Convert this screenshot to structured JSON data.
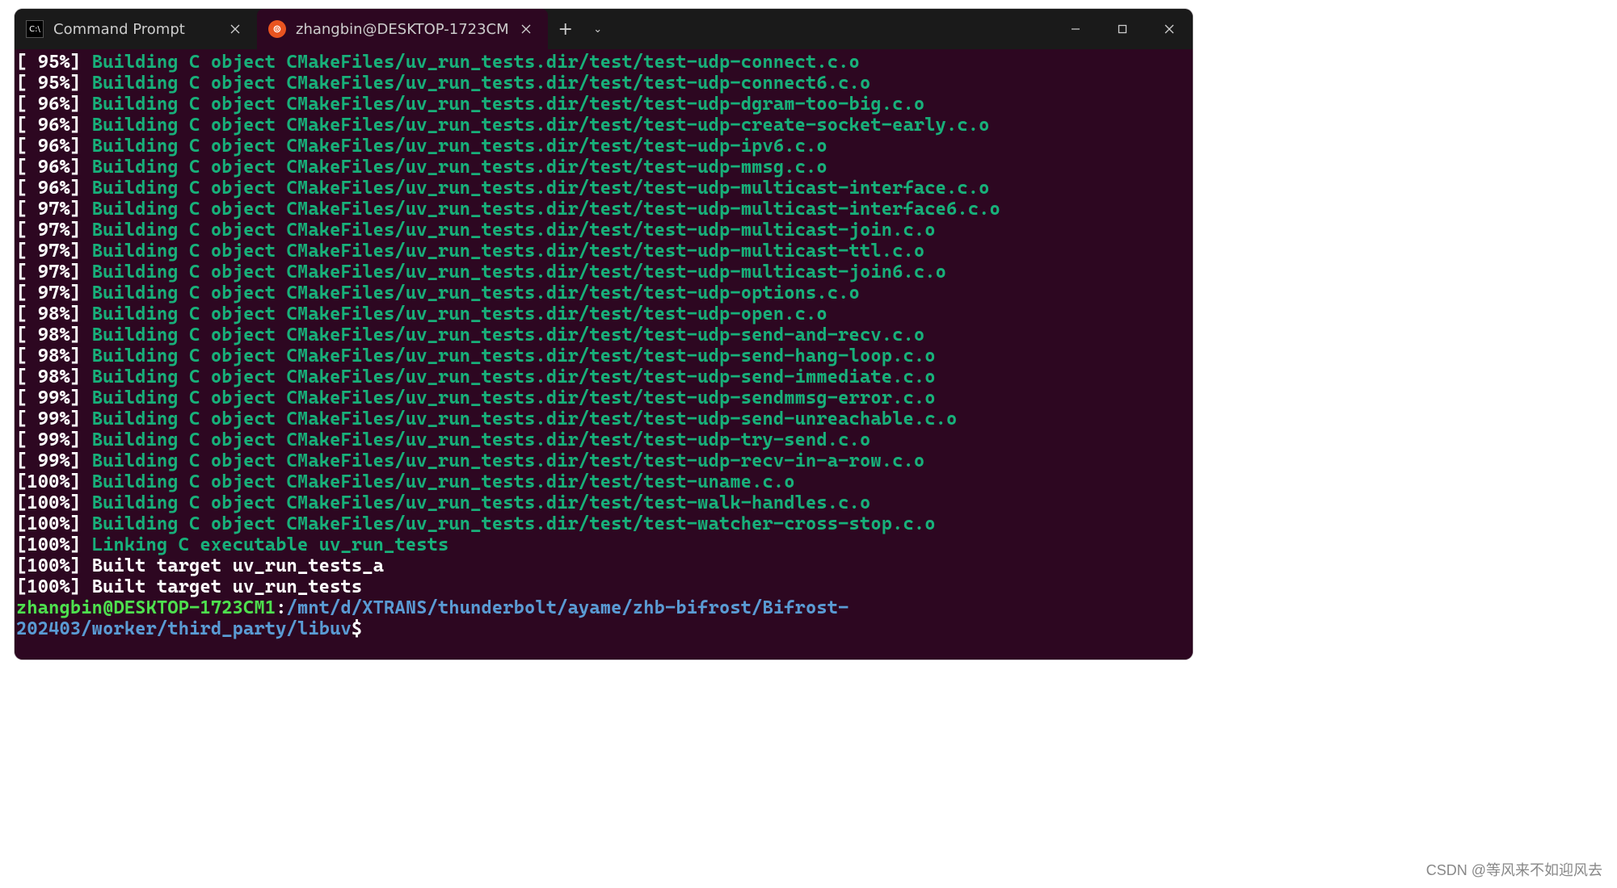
{
  "tabs": [
    {
      "label": "Command Prompt",
      "icon": "cmd",
      "active": false
    },
    {
      "label": "zhangbin@DESKTOP-1723CM",
      "icon": "ubu",
      "active": true
    }
  ],
  "lines": [
    {
      "pct": "[ 95%]",
      "kind": "build",
      "text": "Building C object CMakeFiles/uv_run_tests.dir/test/test-udp-connect.c.o"
    },
    {
      "pct": "[ 95%]",
      "kind": "build",
      "text": "Building C object CMakeFiles/uv_run_tests.dir/test/test-udp-connect6.c.o"
    },
    {
      "pct": "[ 96%]",
      "kind": "build",
      "text": "Building C object CMakeFiles/uv_run_tests.dir/test/test-udp-dgram-too-big.c.o"
    },
    {
      "pct": "[ 96%]",
      "kind": "build",
      "text": "Building C object CMakeFiles/uv_run_tests.dir/test/test-udp-create-socket-early.c.o"
    },
    {
      "pct": "[ 96%]",
      "kind": "build",
      "text": "Building C object CMakeFiles/uv_run_tests.dir/test/test-udp-ipv6.c.o"
    },
    {
      "pct": "[ 96%]",
      "kind": "build",
      "text": "Building C object CMakeFiles/uv_run_tests.dir/test/test-udp-mmsg.c.o"
    },
    {
      "pct": "[ 96%]",
      "kind": "build",
      "text": "Building C object CMakeFiles/uv_run_tests.dir/test/test-udp-multicast-interface.c.o"
    },
    {
      "pct": "[ 97%]",
      "kind": "build",
      "text": "Building C object CMakeFiles/uv_run_tests.dir/test/test-udp-multicast-interface6.c.o"
    },
    {
      "pct": "[ 97%]",
      "kind": "build",
      "text": "Building C object CMakeFiles/uv_run_tests.dir/test/test-udp-multicast-join.c.o"
    },
    {
      "pct": "[ 97%]",
      "kind": "build",
      "text": "Building C object CMakeFiles/uv_run_tests.dir/test/test-udp-multicast-ttl.c.o"
    },
    {
      "pct": "[ 97%]",
      "kind": "build",
      "text": "Building C object CMakeFiles/uv_run_tests.dir/test/test-udp-multicast-join6.c.o"
    },
    {
      "pct": "[ 97%]",
      "kind": "build",
      "text": "Building C object CMakeFiles/uv_run_tests.dir/test/test-udp-options.c.o"
    },
    {
      "pct": "[ 98%]",
      "kind": "build",
      "text": "Building C object CMakeFiles/uv_run_tests.dir/test/test-udp-open.c.o"
    },
    {
      "pct": "[ 98%]",
      "kind": "build",
      "text": "Building C object CMakeFiles/uv_run_tests.dir/test/test-udp-send-and-recv.c.o"
    },
    {
      "pct": "[ 98%]",
      "kind": "build",
      "text": "Building C object CMakeFiles/uv_run_tests.dir/test/test-udp-send-hang-loop.c.o"
    },
    {
      "pct": "[ 98%]",
      "kind": "build",
      "text": "Building C object CMakeFiles/uv_run_tests.dir/test/test-udp-send-immediate.c.o"
    },
    {
      "pct": "[ 99%]",
      "kind": "build",
      "text": "Building C object CMakeFiles/uv_run_tests.dir/test/test-udp-sendmmsg-error.c.o"
    },
    {
      "pct": "[ 99%]",
      "kind": "build",
      "text": "Building C object CMakeFiles/uv_run_tests.dir/test/test-udp-send-unreachable.c.o"
    },
    {
      "pct": "[ 99%]",
      "kind": "build",
      "text": "Building C object CMakeFiles/uv_run_tests.dir/test/test-udp-try-send.c.o"
    },
    {
      "pct": "[ 99%]",
      "kind": "build",
      "text": "Building C object CMakeFiles/uv_run_tests.dir/test/test-udp-recv-in-a-row.c.o"
    },
    {
      "pct": "[100%]",
      "kind": "build",
      "text": "Building C object CMakeFiles/uv_run_tests.dir/test/test-uname.c.o"
    },
    {
      "pct": "[100%]",
      "kind": "build",
      "text": "Building C object CMakeFiles/uv_run_tests.dir/test/test-walk-handles.c.o"
    },
    {
      "pct": "[100%]",
      "kind": "build",
      "text": "Building C object CMakeFiles/uv_run_tests.dir/test/test-watcher-cross-stop.c.o"
    },
    {
      "pct": "[100%]",
      "kind": "link",
      "text": "Linking C executable uv_run_tests"
    },
    {
      "pct": "[100%]",
      "kind": "plain",
      "text": "Built target uv_run_tests_a"
    },
    {
      "pct": "[100%]",
      "kind": "plain",
      "text": "Built target uv_run_tests"
    }
  ],
  "prompt": {
    "user": "zhangbin@DESKTOP-1723CM1",
    "colon": ":",
    "path": "/mnt/d/XTRANS/thunderbolt/ayame/zhb-bifrost/Bifrost-202403/worker/third_party/libuv",
    "dollar": "$"
  },
  "watermark": "CSDN @等风来不如迎风去"
}
